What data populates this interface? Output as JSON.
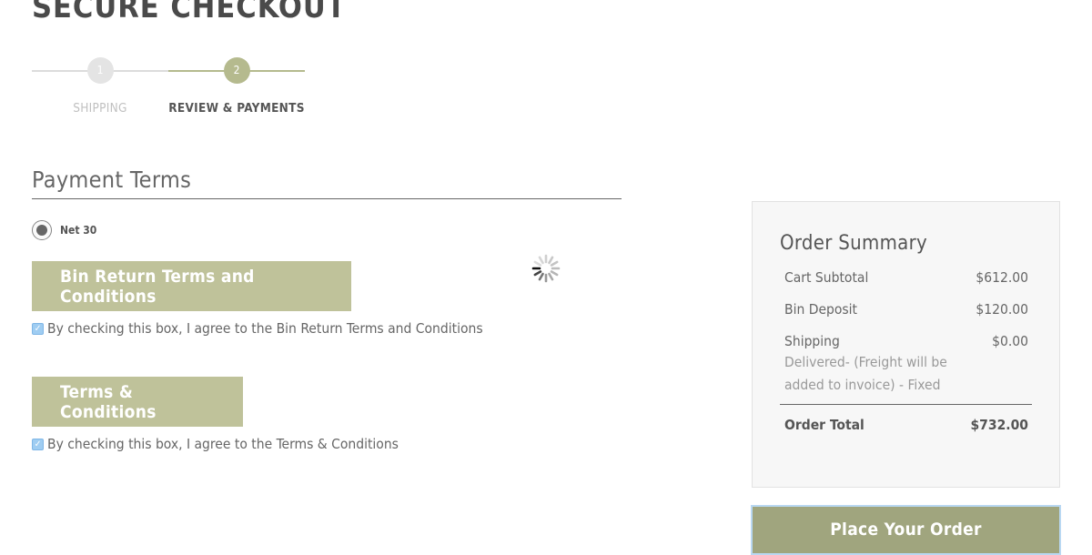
{
  "page": {
    "title": "SECURE CHECKOUT"
  },
  "progress": {
    "steps": [
      {
        "number": "1",
        "label": "SHIPPING"
      },
      {
        "number": "2",
        "label": "REVIEW & PAYMENTS"
      }
    ],
    "current_step": 2
  },
  "payment_terms": {
    "title": "Payment Terms",
    "option_label": "Net 30",
    "selected": true
  },
  "bin_return": {
    "button_label": "Bin Return Terms and Conditions",
    "agree_text": "By checking this box, I agree to the Bin Return Terms and Conditions",
    "checked": true
  },
  "terms": {
    "button_label": "Terms & Conditions",
    "agree_text": "By checking this box, I agree to the Terms & Conditions",
    "checked": true
  },
  "order_summary": {
    "title": "Order Summary",
    "cart_subtotal_label": "Cart Subtotal",
    "cart_subtotal_value": "$612.00",
    "bin_deposit_label": "Bin Deposit",
    "bin_deposit_value": "$120.00",
    "shipping_label": "Shipping",
    "shipping_value": "$0.00",
    "shipping_description": "Delivered- (Freight will be added to invoice) - Fixed",
    "order_total_label": "Order Total",
    "order_total_value": "$732.00"
  },
  "place_order": {
    "label": "Place Your Order"
  },
  "colors": {
    "accent": "#bfc29a",
    "accent_dark": "#a0a57e",
    "checkbox": "#9fcdf2"
  },
  "icons": {
    "spinner": "loading-spinner-icon",
    "radio": "radio-selected",
    "checkbox": "checkmark-icon"
  }
}
